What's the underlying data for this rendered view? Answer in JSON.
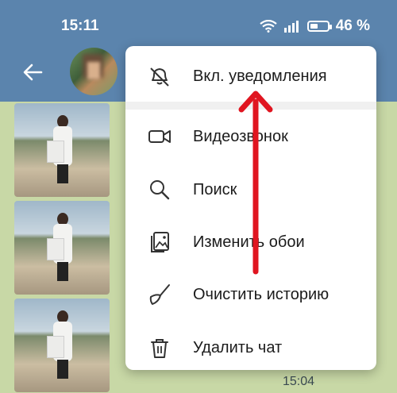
{
  "status_bar": {
    "time": "15:11",
    "battery": "46 %",
    "battery_level": 0.46
  },
  "menu": {
    "items": [
      {
        "label": "Вкл. уведомления",
        "icon": "muted-bell-icon"
      },
      {
        "label": "Видеозвонок",
        "icon": "video-camera-icon"
      },
      {
        "label": "Поиск",
        "icon": "search-icon"
      },
      {
        "label": "Изменить обои",
        "icon": "wallpaper-icon"
      },
      {
        "label": "Очистить историю",
        "icon": "broom-icon"
      },
      {
        "label": "Удалить чат",
        "icon": "trash-icon"
      }
    ]
  },
  "chat": {
    "last_time": "15:04"
  },
  "colors": {
    "header": "#5b84ad",
    "chat_bg": "#c8d8a6",
    "arrow": "#e01520"
  }
}
